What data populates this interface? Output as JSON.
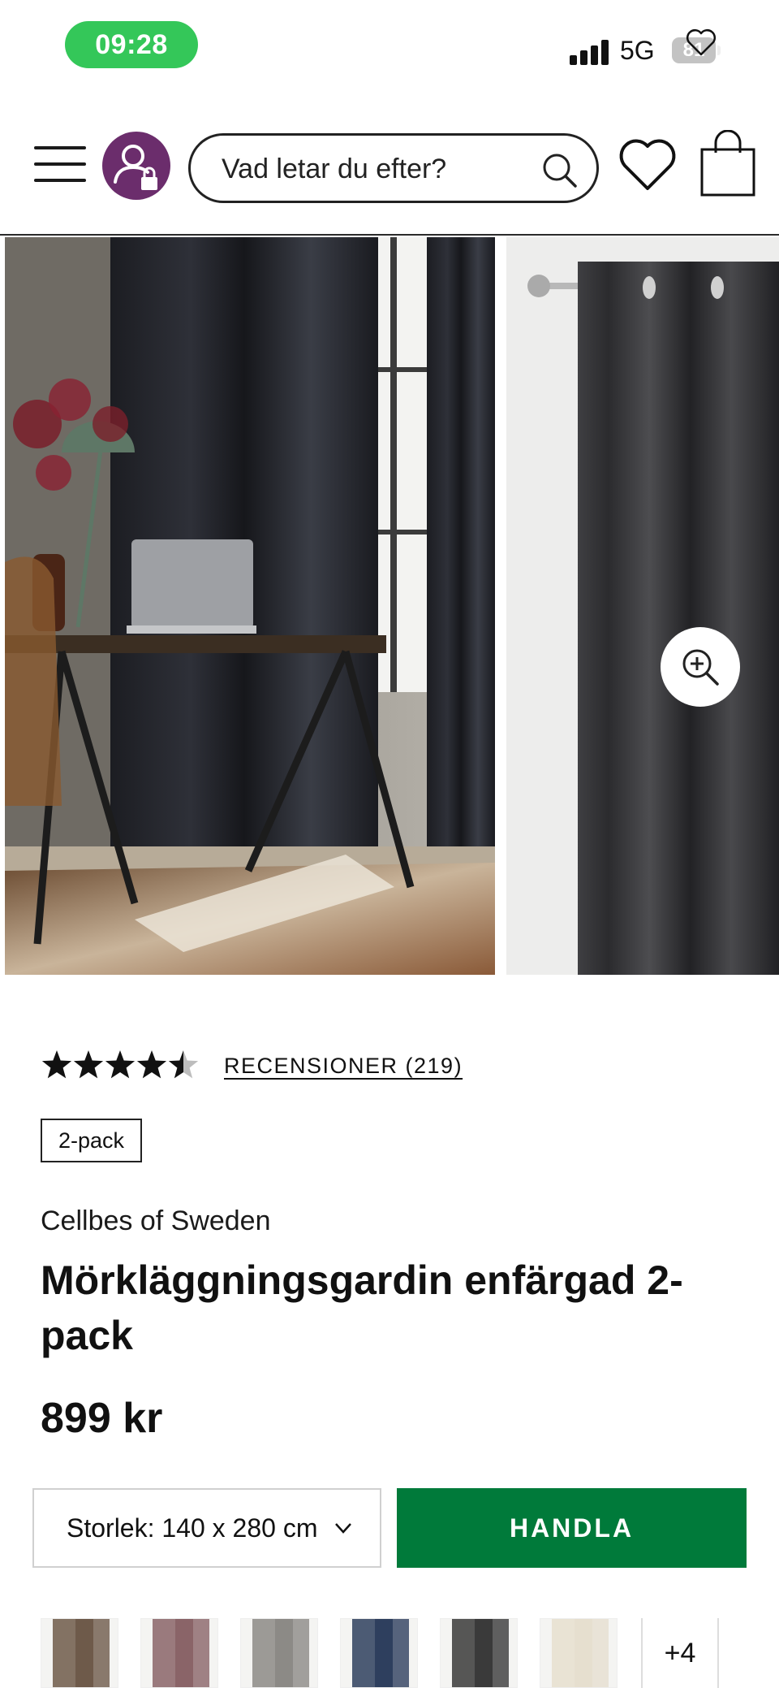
{
  "status_bar": {
    "time": "09:28",
    "network": "5G",
    "battery": "81"
  },
  "header": {
    "search_placeholder": "Vad letar du efter?",
    "icons": [
      "menu-icon",
      "user-locked-icon",
      "search-icon",
      "heart-icon",
      "shopping-bag-icon"
    ]
  },
  "gallery": {
    "icons": [
      "heart-icon",
      "zoom-in-icon"
    ]
  },
  "product": {
    "rating": 4.5,
    "rating_max": 5,
    "reviews_label": "RECENSIONER (219)",
    "badge": "2-pack",
    "brand": "Cellbes of Sweden",
    "title": "Mörkläggningsgardin enfärgad 2-pack",
    "price": "899 kr",
    "size_label": "Storlek: 140 x 280 cm",
    "buy_label": "HANDLA",
    "more_colors": "+4"
  },
  "colors": {
    "accent_green": "#007a3a",
    "avatar_purple": "#6b2d6c",
    "status_green": "#34c759",
    "swatches": [
      "#6e5a4a",
      "#8a6468",
      "#8c8a86",
      "#2e3f5e",
      "#3a3a3a",
      "#e6dfcf"
    ]
  }
}
